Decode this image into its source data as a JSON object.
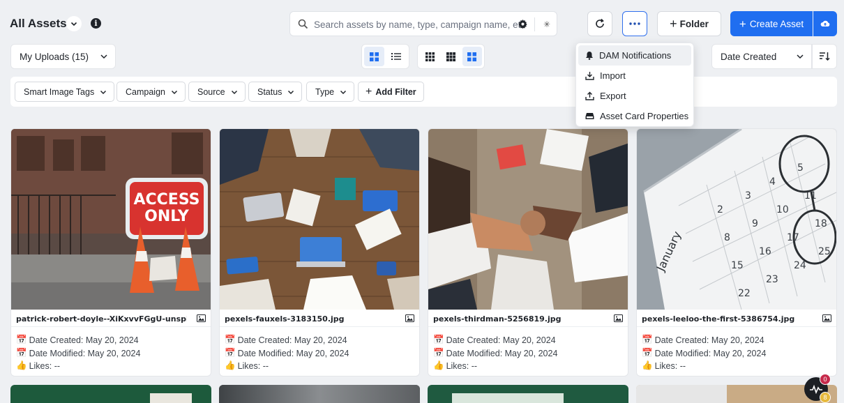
{
  "header": {
    "title": "All Assets",
    "search_placeholder": "Search assets by name, type, campaign name, etc",
    "folder_label": "Folder",
    "create_label": "Create Asset",
    "accent_color": "#1f6ef0"
  },
  "toolbar": {
    "uploads_label": "My Uploads (15)",
    "sort_label": "Date Created"
  },
  "filters": [
    {
      "label": "Smart Image Tags"
    },
    {
      "label": "Campaign"
    },
    {
      "label": "Source"
    },
    {
      "label": "Status"
    },
    {
      "label": "Type"
    }
  ],
  "add_filter_label": "Add Filter",
  "menu": {
    "items": [
      {
        "label": "DAM Notifications",
        "icon": "bell-icon"
      },
      {
        "label": "Import",
        "icon": "import-icon"
      },
      {
        "label": "Export",
        "icon": "export-icon"
      },
      {
        "label": "Asset Card Properties",
        "icon": "card-icon"
      }
    ]
  },
  "assets": [
    {
      "filename": "patrick-robert-doyle--XiKxvvFGgU-unsplash.j",
      "created": "Date Created: May 20, 2024",
      "modified": "Date Modified: May 20, 2024",
      "likes": "Likes: --",
      "sign_line1": "ACCESS",
      "sign_line2": "ONLY"
    },
    {
      "filename": "pexels-fauxels-3183150.jpg",
      "created": "Date Created: May 20, 2024",
      "modified": "Date Modified: May 20, 2024",
      "likes": "Likes: --"
    },
    {
      "filename": "pexels-thirdman-5256819.jpg",
      "created": "Date Created: May 20, 2024",
      "modified": "Date Modified: May 20, 2024",
      "likes": "Likes: --"
    },
    {
      "filename": "pexels-leeloo-the-first-5386754.jpg",
      "created": "Date Created: May 20, 2024",
      "modified": "Date Modified: May 20, 2024",
      "likes": "Likes: --",
      "calendar_month": "January"
    }
  ],
  "fab": {
    "badge_top": "0",
    "badge_bottom": "8"
  }
}
